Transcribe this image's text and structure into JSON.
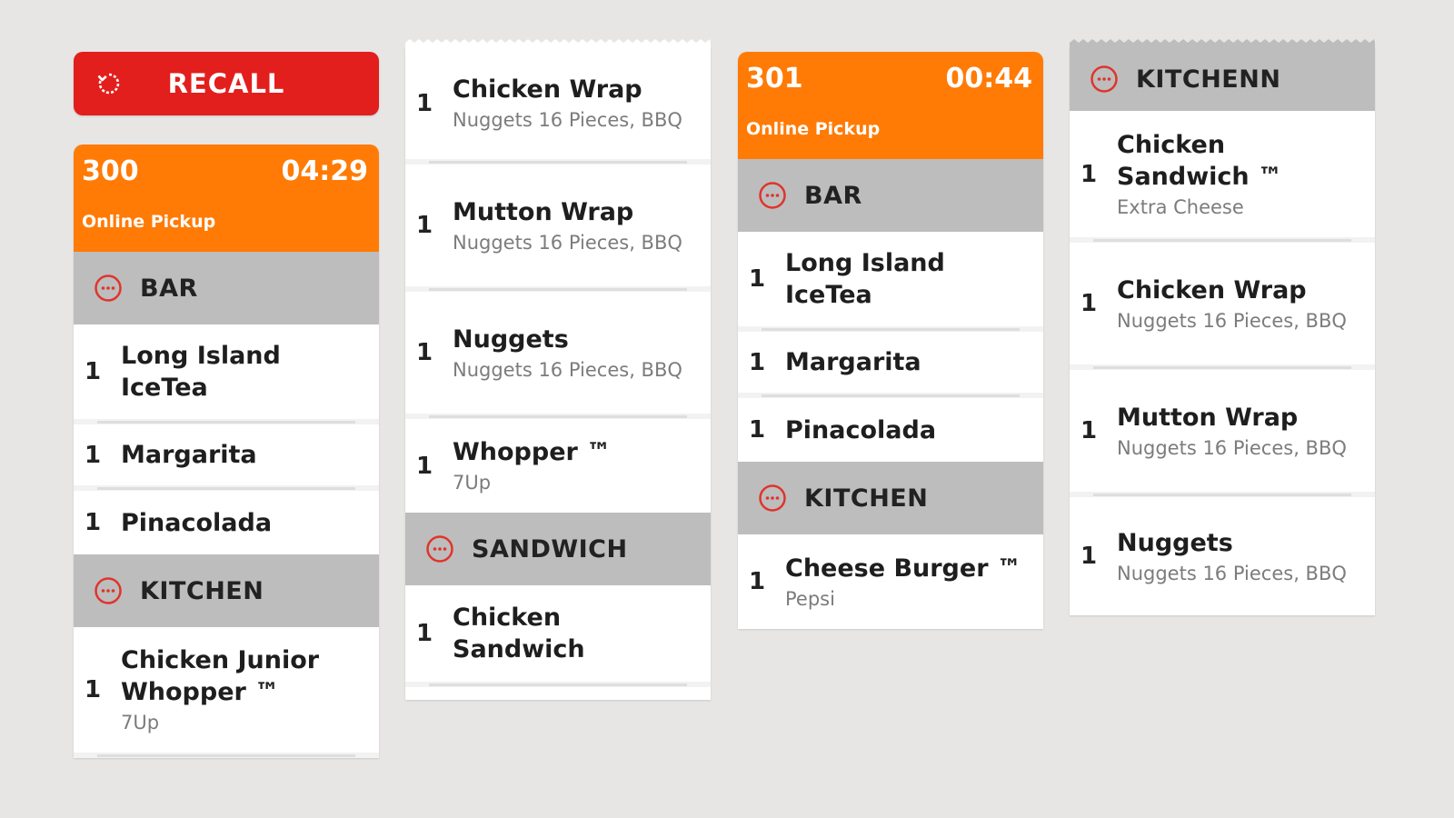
{
  "recall": {
    "label": "RECALL"
  },
  "tickets": {
    "t300": {
      "number": "300",
      "time": "04:29",
      "type": "Online Pickup",
      "sections": {
        "bar": {
          "label": "BAR",
          "items": [
            {
              "qty": "1",
              "name": "Long Island IceTea"
            },
            {
              "qty": "1",
              "name": "Margarita"
            },
            {
              "qty": "1",
              "name": "Pinacolada"
            }
          ]
        },
        "kitchen": {
          "label": "KITCHEN",
          "items": [
            {
              "qty": "1",
              "name": "Chicken Junior Whopper ™",
              "mod": "7Up"
            }
          ]
        }
      }
    },
    "t300_cont": {
      "kitchen_items": [
        {
          "qty": "1",
          "name": "Chicken Wrap",
          "mod": "Nuggets 16 Pieces, BBQ"
        },
        {
          "qty": "1",
          "name": "Mutton Wrap",
          "mod": "Nuggets 16 Pieces, BBQ"
        },
        {
          "qty": "1",
          "name": "Nuggets",
          "mod": "Nuggets 16 Pieces, BBQ"
        },
        {
          "qty": "1",
          "name": "Whopper ™",
          "mod": "7Up"
        }
      ],
      "sandwich": {
        "label": "SANDWICH",
        "items": [
          {
            "qty": "1",
            "name": "Chicken Sandwich"
          }
        ]
      }
    },
    "t301": {
      "number": "301",
      "time": "00:44",
      "type": "Online Pickup",
      "sections": {
        "bar": {
          "label": "BAR",
          "items": [
            {
              "qty": "1",
              "name": "Long Island IceTea"
            },
            {
              "qty": "1",
              "name": "Margarita"
            },
            {
              "qty": "1",
              "name": "Pinacolada"
            }
          ]
        },
        "kitchen": {
          "label": "KITCHEN",
          "items": [
            {
              "qty": "1",
              "name": "Cheese Burger ™",
              "mod": "Pepsi"
            }
          ]
        }
      }
    },
    "t301_cont": {
      "kitchen": {
        "label": "KITCHENN",
        "items": [
          {
            "qty": "1",
            "name": "Chicken Sandwich ™",
            "mod": "Extra Cheese"
          },
          {
            "qty": "1",
            "name": "Chicken Wrap",
            "mod": "Nuggets 16 Pieces, BBQ"
          },
          {
            "qty": "1",
            "name": "Mutton Wrap",
            "mod": "Nuggets 16 Pieces, BBQ"
          },
          {
            "qty": "1",
            "name": "Nuggets",
            "mod": "Nuggets 16 Pieces, BBQ"
          }
        ]
      }
    }
  },
  "colors": {
    "background": "#e7e6e5",
    "recall": "#e21f1c",
    "ticket_header": "#ff7b06",
    "section_header": "#bdbdbd",
    "section_icon": "#e0342c",
    "modifier_text": "#7c7c7c"
  },
  "icons": {
    "recall": "refresh-icon",
    "section": "more-dots-circle-icon"
  }
}
